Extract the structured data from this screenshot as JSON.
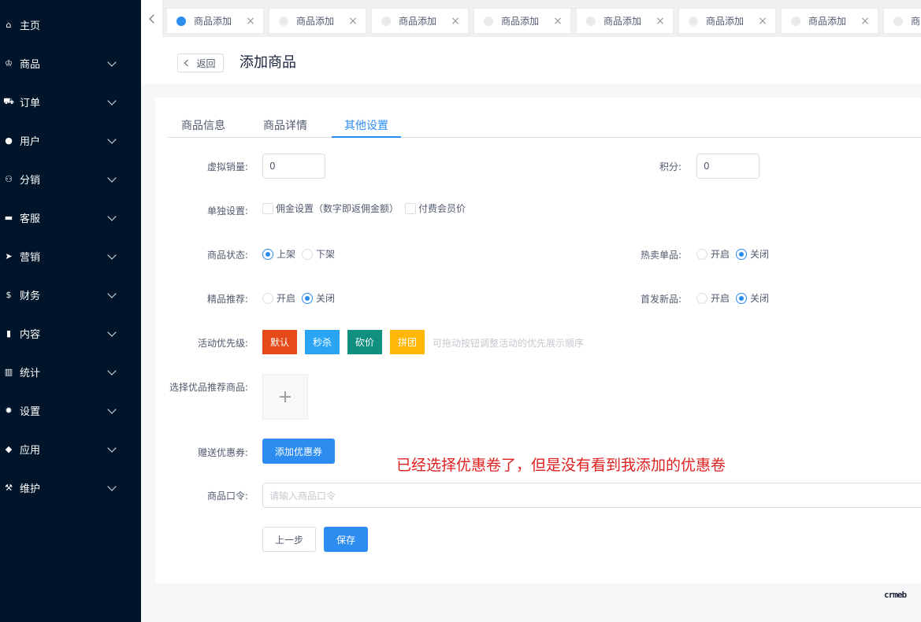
{
  "sidebar": {
    "items": [
      {
        "label": "主页",
        "icon": "home-icon",
        "glyph": "⌂",
        "has_children": false
      },
      {
        "label": "商品",
        "icon": "basket-icon",
        "glyph": "♔",
        "has_children": true
      },
      {
        "label": "订单",
        "icon": "cart-icon",
        "glyph": "⛟",
        "has_children": true
      },
      {
        "label": "用户",
        "icon": "user-icon",
        "glyph": "●",
        "has_children": true
      },
      {
        "label": "分销",
        "icon": "users-icon",
        "glyph": "⚇",
        "has_children": true
      },
      {
        "label": "客服",
        "icon": "chat-icon",
        "glyph": "▬",
        "has_children": true
      },
      {
        "label": "营销",
        "icon": "send-icon",
        "glyph": "➤",
        "has_children": true
      },
      {
        "label": "财务",
        "icon": "dollar-icon",
        "glyph": "$",
        "has_children": true
      },
      {
        "label": "内容",
        "icon": "book-icon",
        "glyph": "▮",
        "has_children": true
      },
      {
        "label": "统计",
        "icon": "bar-chart-icon",
        "glyph": "▥",
        "has_children": true
      },
      {
        "label": "设置",
        "icon": "gear-icon",
        "glyph": "✹",
        "has_children": true
      },
      {
        "label": "应用",
        "icon": "cube-icon",
        "glyph": "◆",
        "has_children": true
      },
      {
        "label": "维护",
        "icon": "wrench-icon",
        "glyph": "⚒",
        "has_children": true
      }
    ]
  },
  "tabbar": {
    "tabs": [
      {
        "label": "商品添加",
        "active": true
      },
      {
        "label": "商品添加",
        "active": false
      },
      {
        "label": "商品添加",
        "active": false
      },
      {
        "label": "商品添加",
        "active": false
      },
      {
        "label": "商品添加",
        "active": false
      },
      {
        "label": "商品添加",
        "active": false
      },
      {
        "label": "商品添加",
        "active": false
      },
      {
        "label": "商品添加",
        "active": false
      }
    ],
    "close_glyph": "×"
  },
  "header": {
    "back_label": "返回",
    "title": "添加商品"
  },
  "page_tabs": [
    {
      "label": "商品信息",
      "active": false
    },
    {
      "label": "商品详情",
      "active": false
    },
    {
      "label": "其他设置",
      "active": true
    }
  ],
  "form": {
    "virtual_sales": {
      "label": "虚拟销量:",
      "value": "0"
    },
    "points": {
      "label": "积分:",
      "value": "0"
    },
    "individual_settings": {
      "label": "单独设置:",
      "options": [
        {
          "label": "佣金设置（数字即返佣金额）",
          "checked": false
        },
        {
          "label": "付费会员价",
          "checked": false
        }
      ]
    },
    "product_status": {
      "label": "商品状态:",
      "options": [
        {
          "label": "上架",
          "checked": true
        },
        {
          "label": "下架",
          "checked": false
        }
      ]
    },
    "hot_item": {
      "label": "热卖单品:",
      "options": [
        {
          "label": "开启",
          "checked": false
        },
        {
          "label": "关闭",
          "checked": true
        }
      ]
    },
    "featured": {
      "label": "精品推荐:",
      "options": [
        {
          "label": "开启",
          "checked": false
        },
        {
          "label": "关闭",
          "checked": true
        }
      ]
    },
    "new_item": {
      "label": "首发新品:",
      "options": [
        {
          "label": "开启",
          "checked": false
        },
        {
          "label": "关闭",
          "checked": true
        }
      ]
    },
    "activity_priority": {
      "label": "活动优先级:",
      "buttons": [
        {
          "label": "默认",
          "color": "#e64a19"
        },
        {
          "label": "秒杀",
          "color": "#2aa4f4"
        },
        {
          "label": "砍价",
          "color": "#0f8f7e"
        },
        {
          "label": "拼团",
          "color": "#ffb607"
        }
      ],
      "hint": "可拖动按钮调整活动的优先展示顺序"
    },
    "recommend_goods": {
      "label": "选择优品推荐商品:",
      "plus_glyph": "+"
    },
    "coupons": {
      "label": "赠送优惠券:",
      "button_label": "添加优惠券"
    },
    "command": {
      "label": "商品口令:",
      "placeholder": "请输入商品口令"
    },
    "prev_button": "上一步",
    "save_button": "保存"
  },
  "annotation": "已经选择优惠卷了，但是没有看到我添加的优惠卷",
  "logo_text": "crmeb",
  "colors": {
    "sidebar_bg": "#001529",
    "primary": "#2d8cf0",
    "annotation": "#e02020"
  }
}
